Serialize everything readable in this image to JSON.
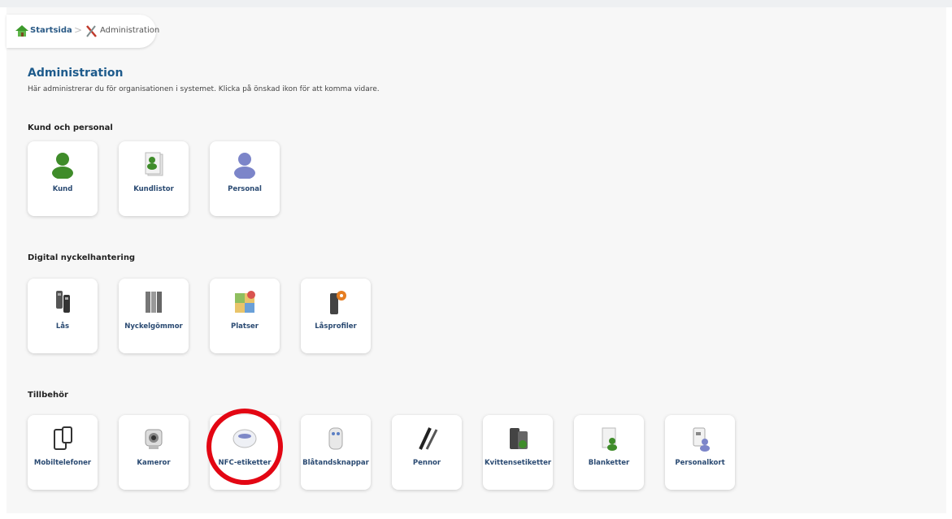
{
  "breadcrumb": {
    "home_label": "Startsida",
    "current_label": "Administration"
  },
  "page": {
    "title": "Administration",
    "description": "Här administrerar du för organisationen i systemet. Klicka på önskad ikon för att komma vidare."
  },
  "sections": [
    {
      "title": "Kund och personal",
      "tiles": [
        {
          "label": "Kund",
          "icon": "person-green-icon"
        },
        {
          "label": "Kundlistor",
          "icon": "customer-list-icon"
        },
        {
          "label": "Personal",
          "icon": "person-blue-icon"
        }
      ]
    },
    {
      "title": "Digital nyckelhantering",
      "tiles": [
        {
          "label": "Lås",
          "icon": "lock-devices-icon"
        },
        {
          "label": "Nyckelgömmor",
          "icon": "key-safe-icon"
        },
        {
          "label": "Platser",
          "icon": "map-places-icon"
        },
        {
          "label": "Låsprofiler",
          "icon": "lock-profile-icon"
        }
      ]
    },
    {
      "title": "Tillbehör",
      "tiles": [
        {
          "label": "Mobiltelefoner",
          "icon": "mobile-phone-icon"
        },
        {
          "label": "Kameror",
          "icon": "camera-icon"
        },
        {
          "label": "NFC-etiketter",
          "icon": "nfc-tag-icon"
        },
        {
          "label": "Blåtandsknappar",
          "icon": "bluetooth-button-icon"
        },
        {
          "label": "Pennor",
          "icon": "pens-icon"
        },
        {
          "label": "Kvittensetiketter",
          "icon": "receipt-label-icon"
        },
        {
          "label": "Blanketter",
          "icon": "forms-icon"
        },
        {
          "label": "Personalkort",
          "icon": "staff-card-icon"
        }
      ]
    }
  ],
  "colors": {
    "title": "#1e5b8c",
    "tile_label": "#2a4a72",
    "highlight": "#e30613"
  }
}
